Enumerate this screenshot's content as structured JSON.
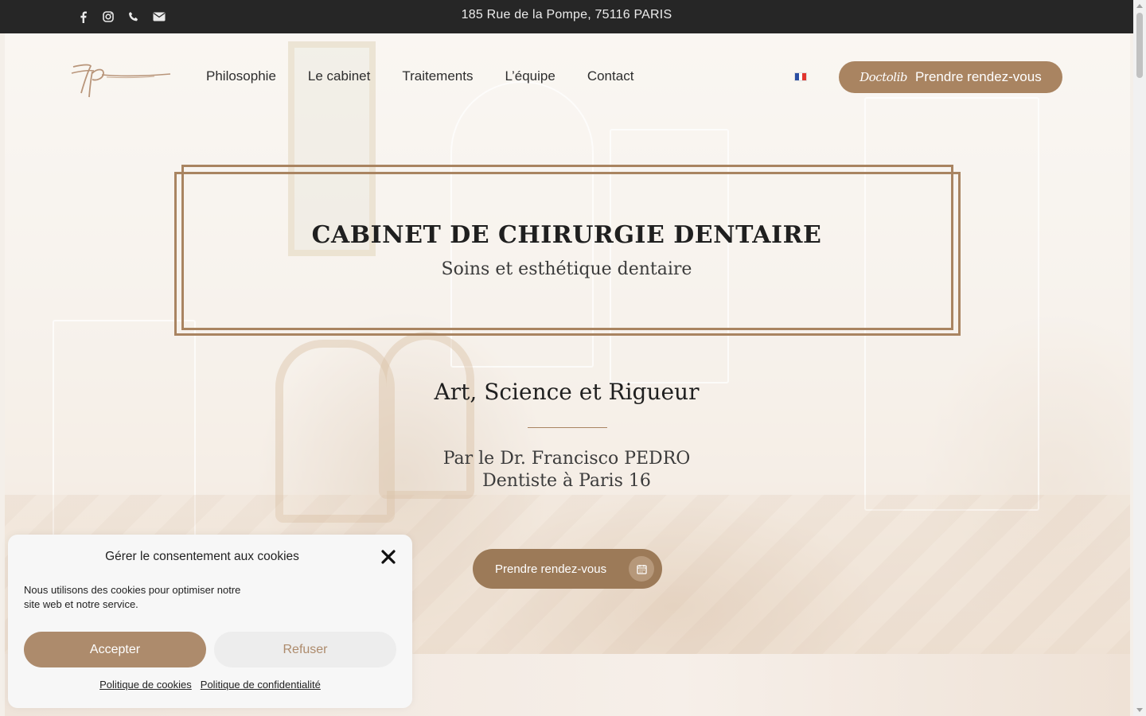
{
  "topbar": {
    "address": "185 Rue de la Pompe, 75116 PARIS",
    "social_icons": [
      "facebook-icon",
      "instagram-icon",
      "phone-icon",
      "envelope-icon"
    ]
  },
  "header": {
    "logo_text": "Fp",
    "nav": [
      "Philosophie",
      "Le cabinet",
      "Traitements",
      "L’équipe",
      "Contact"
    ],
    "language_flag": "fr-flag-icon",
    "cta": {
      "brand": "Doctolib",
      "label": "Prendre rendez-vous"
    }
  },
  "hero": {
    "title": "CABINET DE CHIRURGIE DENTAIRE",
    "subtitle": "Soins et esthétique dentaire",
    "tagline": "Art, Science et Rigueur",
    "doctor_line1": "Par le Dr. Francisco PEDRO",
    "doctor_line2": "Dentiste à Paris 16",
    "cta": "Prendre rendez-vous"
  },
  "cookie_banner": {
    "title": "Gérer le consentement aux cookies",
    "text": "Nous utilisons des cookies pour optimiser notre site web et notre service.",
    "accept": "Accepter",
    "refuse": "Refuser",
    "link_cookies": "Politique de cookies",
    "link_privacy": "Politique de confidentialité"
  },
  "colors": {
    "accent": "#a98461",
    "topbar": "#262626",
    "button_secondary": "#ededed"
  }
}
